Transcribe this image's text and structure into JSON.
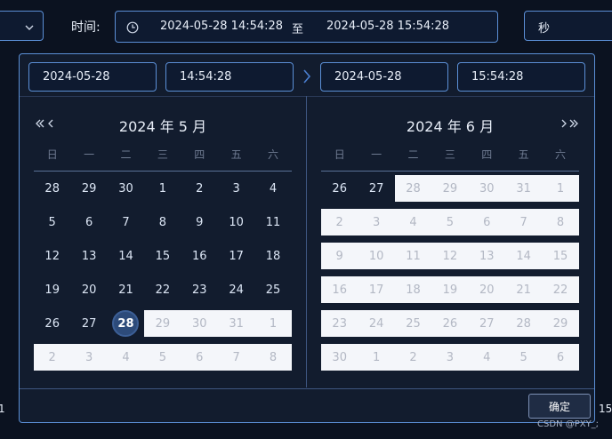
{
  "filter_bar": {
    "time_label": "时间:",
    "start_datetime": "2024-05-28 14:54:28",
    "separator": "至",
    "end_datetime": "2024-05-28 15:54:28",
    "unit_select": "秒"
  },
  "picker": {
    "start_date_input": "2024-05-28",
    "start_time_input": "14:54:28",
    "end_date_input": "2024-05-28",
    "end_time_input": "15:54:28",
    "confirm_label": "确定",
    "weekdays": [
      "日",
      "一",
      "二",
      "三",
      "四",
      "五",
      "六"
    ],
    "left": {
      "title": "2024 年 5 月",
      "weeks": [
        [
          "28",
          "29",
          "30",
          "1",
          "2",
          "3",
          "4"
        ],
        [
          "5",
          "6",
          "7",
          "8",
          "9",
          "10",
          "11"
        ],
        [
          "12",
          "13",
          "14",
          "15",
          "16",
          "17",
          "18"
        ],
        [
          "19",
          "20",
          "21",
          "22",
          "23",
          "24",
          "25"
        ],
        [
          "26",
          "27",
          "28",
          "29",
          "30",
          "31",
          "1"
        ],
        [
          "2",
          "3",
          "4",
          "5",
          "6",
          "7",
          "8"
        ]
      ]
    },
    "right": {
      "title": "2024 年 6 月",
      "weeks": [
        [
          "26",
          "27",
          "28",
          "29",
          "30",
          "31",
          "1"
        ],
        [
          "2",
          "3",
          "4",
          "5",
          "6",
          "7",
          "8"
        ],
        [
          "9",
          "10",
          "11",
          "12",
          "13",
          "14",
          "15"
        ],
        [
          "16",
          "17",
          "18",
          "19",
          "20",
          "21",
          "22"
        ],
        [
          "23",
          "24",
          "25",
          "26",
          "27",
          "28",
          "29"
        ],
        [
          "30",
          "1",
          "2",
          "3",
          "4",
          "5",
          "6"
        ]
      ]
    }
  },
  "background_fragments": {
    "left_edge": "1",
    "right_edge": "15:"
  },
  "watermark": "CSDN @PXY_;"
}
